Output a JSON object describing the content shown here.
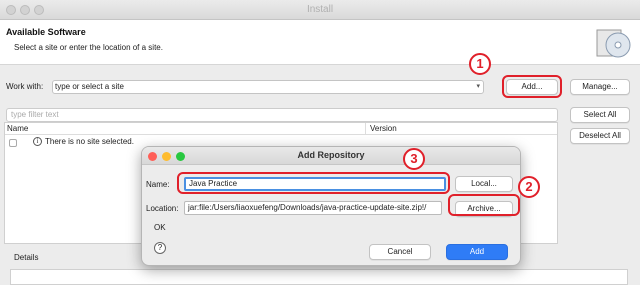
{
  "window": {
    "title": "Install"
  },
  "header": {
    "title": "Available Software",
    "subtitle": "Select a site or enter the location of a site."
  },
  "work_with": {
    "label": "Work with:",
    "value": "type or select a site",
    "add_label": "Add...",
    "manage_label": "Manage..."
  },
  "filter": {
    "placeholder": "type filter text",
    "select_all": "Select All",
    "deselect_all": "Deselect All"
  },
  "table": {
    "col_name": "Name",
    "col_version": "Version",
    "empty_message": "There is no site selected."
  },
  "details": {
    "label": "Details"
  },
  "annotations": {
    "one": "1",
    "two": "2",
    "three": "3",
    "color": "#e0202a"
  },
  "dialog": {
    "title": "Add Repository",
    "name_label": "Name:",
    "name_value": "Java Practice",
    "location_label": "Location:",
    "location_value": "jar:file:/Users/liaoxuefeng/Downloads/java-practice-update-site.zip!/",
    "local_label": "Local...",
    "archive_label": "Archive...",
    "ok_label": "OK",
    "help_icon": "?",
    "cancel_label": "Cancel",
    "add_label": "Add"
  }
}
